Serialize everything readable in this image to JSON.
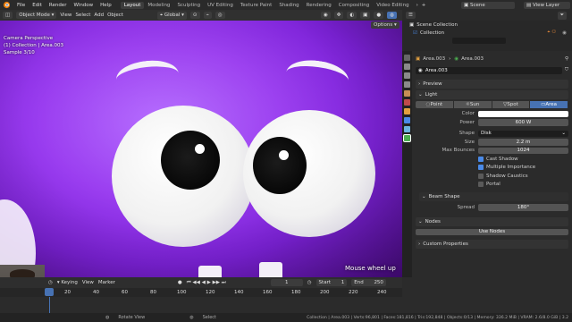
{
  "topbar": {
    "menus": [
      "File",
      "Edit",
      "Render",
      "Window",
      "Help"
    ],
    "workspaces": [
      "Layout",
      "Modeling",
      "Sculpting",
      "UV Editing",
      "Texture Paint",
      "Shading",
      "Rendering",
      "Compositing",
      "Video Editing"
    ],
    "active_workspace": "Layout",
    "scene_label": "Scene",
    "view_layer_label": "View Layer"
  },
  "viewport_header": {
    "mode": "Object Mode",
    "menus": [
      "View",
      "Select",
      "Add",
      "Object"
    ],
    "transform": "Global",
    "options_label": "Options"
  },
  "viewport": {
    "overlay_lines": [
      "Camera Perspective",
      "(1) Collection | Area.003",
      "Sample 3/10"
    ],
    "hint": "Mouse wheel up"
  },
  "outliner": {
    "rows": [
      "Scene Collection",
      "Collection"
    ]
  },
  "properties": {
    "breadcrumb_object": "Area.003",
    "breadcrumb_data": "Area.003",
    "data_name": "Area.003",
    "preview_label": "Preview",
    "light_label": "Light",
    "light_types": [
      "Point",
      "Sun",
      "Spot",
      "Area"
    ],
    "active_light_type": "Area",
    "fields": {
      "color_label": "Color",
      "power_label": "Power",
      "power_value": "600 W",
      "shape_label": "Shape",
      "shape_value": "Disk",
      "size_label": "Size",
      "size_value": "2.2 m",
      "max_bounces_label": "Max Bounces",
      "max_bounces_value": "1024"
    },
    "checkboxes": [
      {
        "label": "Cast Shadow",
        "checked": true
      },
      {
        "label": "Multiple Importance",
        "checked": true
      },
      {
        "label": "Shadow Caustics",
        "checked": false
      },
      {
        "label": "Portal",
        "checked": false
      }
    ],
    "beam_shape_label": "Beam Shape",
    "spread_label": "Spread",
    "spread_value": "180°",
    "nodes_label": "Nodes",
    "use_nodes_label": "Use Nodes",
    "custom_props_label": "Custom Properties"
  },
  "timeline": {
    "keying": "Keying",
    "view": "View",
    "marker": "Marker",
    "current_frame": "1",
    "start_label": "Start",
    "start_value": "1",
    "end_label": "End",
    "end_value": "250",
    "ruler": [
      "20",
      "40",
      "60",
      "80",
      "100",
      "120",
      "140",
      "160",
      "180",
      "200",
      "220",
      "240"
    ]
  },
  "statusbar": {
    "left": "Rotate View",
    "mid": "Select",
    "stats": "Collection | Area.003 | Verts:96,801 | Faces:181,816 | Tris:192,848 | Objects:0/13 | Memory: 336.2 MiB | VRAM: 2.6/8.0 GiB | 3.2"
  },
  "colors": {
    "accent": "#4772b3",
    "body_purple": "#9a3df0"
  }
}
